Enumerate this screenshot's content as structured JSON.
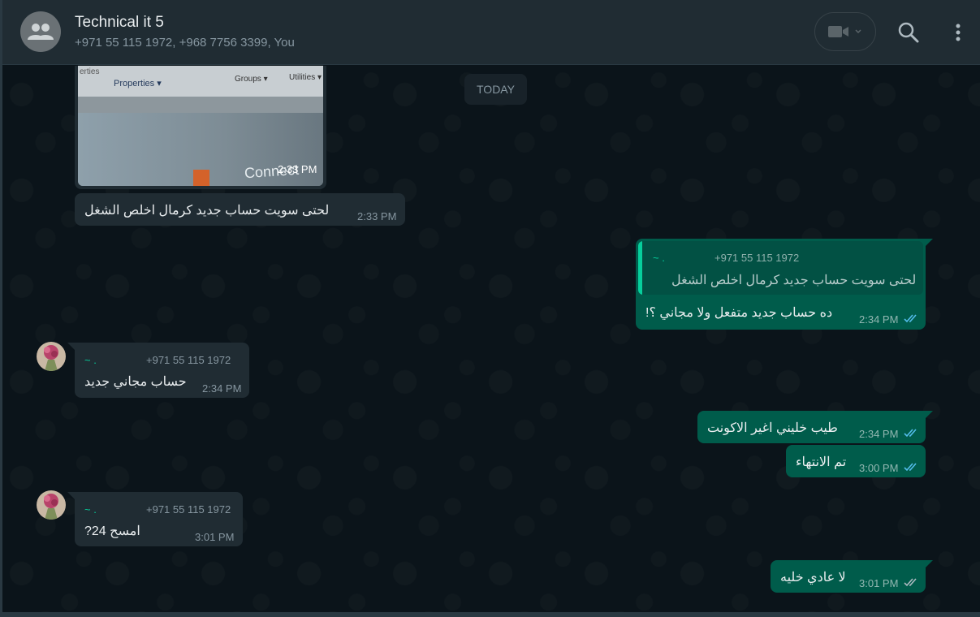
{
  "header": {
    "title": "Technical it 5",
    "subtitle": "+971 55 115 1972, +968 7756 3399, You",
    "icons": [
      "group-avatar-icon",
      "video-call-icon",
      "chevron-down-icon",
      "search-icon",
      "menu-icon"
    ]
  },
  "chat": {
    "date_divider": "TODAY",
    "messages": [
      {
        "direction": "in",
        "type": "image",
        "image_text": {
          "top_left": "erties",
          "tab1": "Properties ▾",
          "tab2": "Groups ▾",
          "tab3": "Utilities ▾",
          "corner": "Connect"
        },
        "time": "2:33 PM"
      },
      {
        "direction": "in",
        "text": "لحتى سويت حساب جديد كرمال اخلص الشغل",
        "time": "2:33 PM"
      },
      {
        "direction": "out",
        "quote": {
          "sender_name": "~ .",
          "sender_phone": "+971 55 115 1972",
          "text": "لحتى سويت حساب جديد كرمال اخلص الشغل"
        },
        "text": "ده حساب جديد متفعل ولا مجاني ؟!",
        "time": "2:34 PM"
      },
      {
        "direction": "in",
        "sender_name": "~ .",
        "sender_phone": "+971 55 115 1972",
        "text": "حساب مجاني جديد",
        "time": "2:34 PM"
      },
      {
        "direction": "out",
        "text": "طيب خليني اغير الاكونت",
        "time": "2:34 PM"
      },
      {
        "direction": "out",
        "text": "تم الانتهاء",
        "time": "3:00 PM"
      },
      {
        "direction": "in",
        "sender_name": "~ .",
        "sender_phone": "+971 55 115 1972",
        "text": "امسح 24?",
        "time": "3:01 PM"
      },
      {
        "direction": "out",
        "text": "لا عادي خليه",
        "time": "3:01 PM",
        "status": "read-ticks-grey"
      }
    ]
  },
  "colors": {
    "background": "#0b141a",
    "header": "#202c33",
    "incoming_bubble": "#202c33",
    "outgoing_bubble": "#005c4b",
    "accent_green": "#06cf9c",
    "read_ticks": "#53bdeb"
  }
}
